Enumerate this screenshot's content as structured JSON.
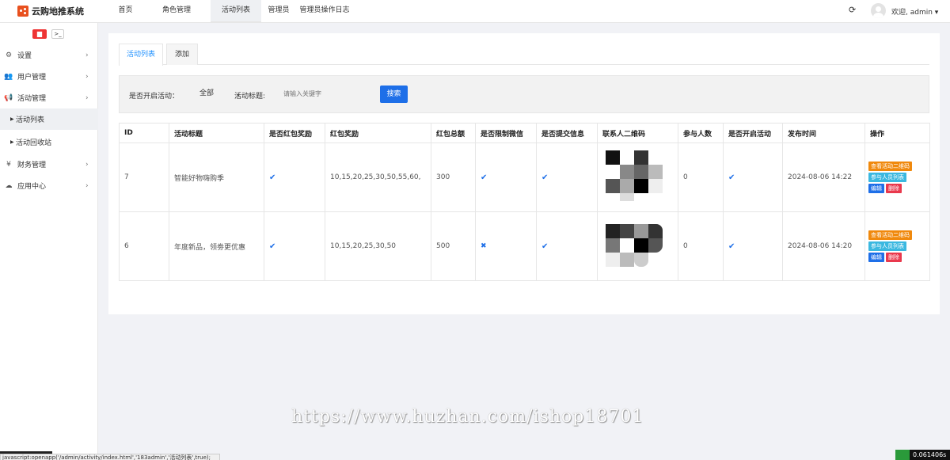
{
  "app": {
    "title": "云购地推系统"
  },
  "topnav": [
    {
      "label": "首页",
      "active": false
    },
    {
      "label": "角色管理",
      "active": false
    },
    {
      "label": "活动列表",
      "active": true
    },
    {
      "label": "管理员",
      "active": false
    },
    {
      "label": "管理员操作日志",
      "active": false
    }
  ],
  "user": {
    "welcome": "欢迎, admin ▾"
  },
  "sidebar": {
    "tools": {
      "delete_icon": "trash-icon",
      "terminal_label": ">_"
    },
    "items": [
      {
        "label": "设置",
        "icon": "gears-icon"
      },
      {
        "label": "用户管理",
        "icon": "users-icon"
      },
      {
        "label": "活动管理",
        "icon": "megaphone-icon"
      }
    ],
    "sub_items": [
      {
        "label": "活动列表",
        "active": true
      },
      {
        "label": "活动回收站",
        "active": false
      }
    ],
    "items_after": [
      {
        "label": "财务管理",
        "icon": "yen-icon"
      },
      {
        "label": "应用中心",
        "icon": "cloud-icon"
      }
    ]
  },
  "tabs": [
    {
      "label": "活动列表",
      "active": true
    },
    {
      "label": "添加",
      "active": false
    }
  ],
  "search": {
    "open_label": "是否开启活动：",
    "open_value": "全部",
    "title_label": "活动标题:",
    "title_placeholder": "请输入关键字",
    "button": "搜索"
  },
  "table": {
    "columns": [
      "ID",
      "活动标题",
      "是否红包奖励",
      "红包奖励",
      "红包总额",
      "是否限制微信",
      "是否提交信息",
      "联系人二维码",
      "参与人数",
      "是否开启活动",
      "发布时间",
      "操作"
    ],
    "rows": [
      {
        "id": "7",
        "title": "智能好物嗨购季",
        "red_packet": true,
        "rewards": "10,15,20,25,30,50,55,60,",
        "total": "300",
        "limit_wechat": true,
        "submit_info": true,
        "participants": "0",
        "enabled": true,
        "time": "2024-08-06 14:22"
      },
      {
        "id": "6",
        "title": "年度新品，领劵更优惠",
        "red_packet": true,
        "rewards": "10,15,20,25,30,50",
        "total": "500",
        "limit_wechat": false,
        "submit_info": true,
        "participants": "0",
        "enabled": true,
        "time": "2024-08-06 14:20"
      }
    ],
    "actions": {
      "qr": "查看活动二维码",
      "members": "参与人员列表",
      "edit": "编辑",
      "delete": "删除"
    }
  },
  "watermark": "https://www.huzhan.com/ishop18701",
  "status_url": "javascript:openapp('/admin/activity/index.html','183admin','活动列表',true);",
  "perf_value": "0.061406s",
  "colors": {
    "accent": "#1e6fe8",
    "orange": "#f0890d",
    "cyan": "#3bb8e0",
    "red": "#e9394d",
    "logo": "#e8501e"
  }
}
